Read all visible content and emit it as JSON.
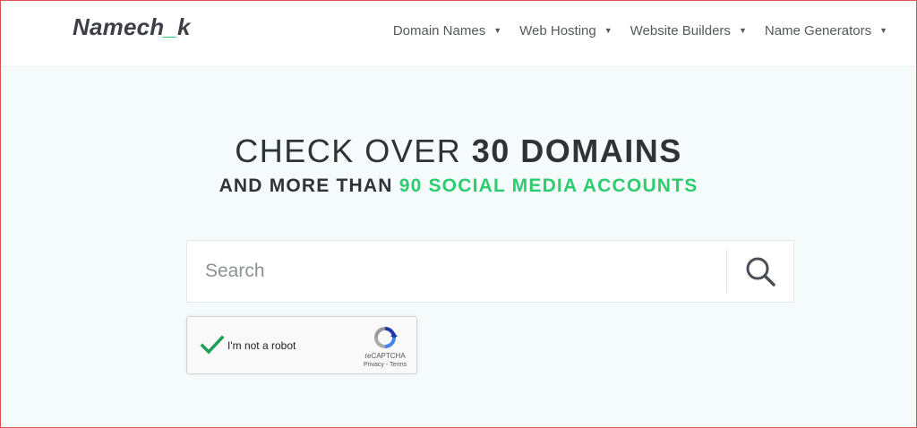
{
  "header": {
    "logo_main": "Namech",
    "logo_accent": "_",
    "logo_end": "k",
    "nav": [
      {
        "label": "Domain Names"
      },
      {
        "label": "Web Hosting"
      },
      {
        "label": "Website Builders"
      },
      {
        "label": "Name Generators"
      }
    ]
  },
  "hero": {
    "headline_normal": "CHECK OVER ",
    "headline_bold": "30 DOMAINS",
    "subline_normal": "AND MORE THAN ",
    "subline_green": "90 SOCIAL MEDIA ACCOUNTS"
  },
  "search": {
    "placeholder": "Search",
    "value": "",
    "button_icon": "search-icon"
  },
  "captcha": {
    "checked": true,
    "label": "I'm not a robot",
    "brand": "reCAPTCHA",
    "privacy": "Privacy",
    "separator": " - ",
    "terms": "Terms"
  },
  "colors": {
    "accent": "#2ecc71",
    "text": "#2f3237",
    "background": "#f5fbfb"
  }
}
